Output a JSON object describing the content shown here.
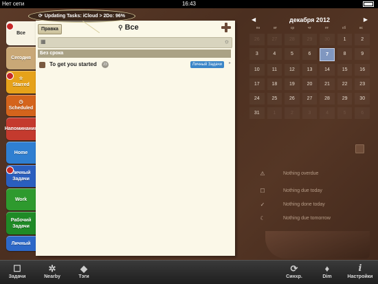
{
  "status_bar": {
    "carrier": "Нет сети",
    "time": "16:43",
    "battery_label": "Battery"
  },
  "sync_bubble": {
    "text": "Updating Tasks: iCloud > 2Do: 96%",
    "icon": "sync-icon"
  },
  "tabs": [
    {
      "label": "Все",
      "color": "#f7f3e4",
      "active": true,
      "icon": "",
      "badge": true
    },
    {
      "label": "Сегодня",
      "color": "#c9a877",
      "active": false,
      "icon": "",
      "badge": false
    },
    {
      "label": "Starred",
      "color": "#e6a21a",
      "active": false,
      "icon": "☆",
      "badge": true
    },
    {
      "label": "Scheduled",
      "color": "#d4641c",
      "active": false,
      "icon": "◷",
      "badge": false
    },
    {
      "label": "Напоминания",
      "color": "#c43a2e",
      "active": false,
      "icon": "",
      "badge": false
    },
    {
      "label": "Home",
      "color": "#2f7fd1",
      "active": false,
      "icon": "",
      "badge": false
    },
    {
      "label": "Личный Задачи",
      "color": "#2a5fbf",
      "active": false,
      "icon": "",
      "badge": true
    },
    {
      "label": "Work",
      "color": "#2e9a2e",
      "active": false,
      "icon": "",
      "badge": false
    },
    {
      "label": "Рабочий Задачи",
      "color": "#1f8a26",
      "active": false,
      "icon": "",
      "badge": false
    },
    {
      "label": "Личный",
      "color": "#2d68c8",
      "active": false,
      "icon": "",
      "badge": false
    }
  ],
  "header": {
    "edit_label": "Правка",
    "title": "Все",
    "search_icon": "magnifier-icon",
    "add_icon": "plus-icon"
  },
  "quick_entry": {
    "left_icon": "calendar-icon",
    "right_icon": "sun-icon"
  },
  "section": {
    "title": "Без срока"
  },
  "task": {
    "name": "To get you started",
    "count": "23",
    "list": "Личный Задачи",
    "list_color": "#3a86c8"
  },
  "calendar": {
    "month": "декабря 2012",
    "weekdays": [
      "пн",
      "вт",
      "ср",
      "чт",
      "пт",
      "сб",
      "вс"
    ],
    "days": [
      {
        "n": "26",
        "other": true
      },
      {
        "n": "27",
        "other": true
      },
      {
        "n": "28",
        "other": true
      },
      {
        "n": "29",
        "other": true
      },
      {
        "n": "30",
        "other": true
      },
      {
        "n": "1",
        "other": false
      },
      {
        "n": "2",
        "other": false
      },
      {
        "n": "3",
        "other": false
      },
      {
        "n": "4",
        "other": false
      },
      {
        "n": "5",
        "other": false
      },
      {
        "n": "6",
        "other": false
      },
      {
        "n": "7",
        "other": false,
        "today": true
      },
      {
        "n": "8",
        "other": false
      },
      {
        "n": "9",
        "other": false
      },
      {
        "n": "10",
        "other": false
      },
      {
        "n": "11",
        "other": false
      },
      {
        "n": "12",
        "other": false
      },
      {
        "n": "13",
        "other": false
      },
      {
        "n": "14",
        "other": false
      },
      {
        "n": "15",
        "other": false
      },
      {
        "n": "16",
        "other": false
      },
      {
        "n": "17",
        "other": false
      },
      {
        "n": "18",
        "other": false
      },
      {
        "n": "19",
        "other": false
      },
      {
        "n": "20",
        "other": false
      },
      {
        "n": "21",
        "other": false
      },
      {
        "n": "22",
        "other": false
      },
      {
        "n": "23",
        "other": false
      },
      {
        "n": "24",
        "other": false
      },
      {
        "n": "25",
        "other": false
      },
      {
        "n": "26",
        "other": false
      },
      {
        "n": "27",
        "other": false
      },
      {
        "n": "28",
        "other": false
      },
      {
        "n": "29",
        "other": false
      },
      {
        "n": "30",
        "other": false
      },
      {
        "n": "31",
        "other": false
      },
      {
        "n": "1",
        "other": true
      },
      {
        "n": "2",
        "other": true
      },
      {
        "n": "3",
        "other": true
      },
      {
        "n": "4",
        "other": true
      },
      {
        "n": "5",
        "other": true
      },
      {
        "n": "6",
        "other": true
      }
    ]
  },
  "summary": [
    {
      "icon": "warning-icon",
      "glyph": "⚠",
      "text": "Nothing overdue"
    },
    {
      "icon": "square-icon",
      "glyph": "☐",
      "text": "Nothing due today"
    },
    {
      "icon": "checkmark-icon",
      "glyph": "✓",
      "text": "Nothing done today"
    },
    {
      "icon": "moon-icon",
      "glyph": "☾",
      "text": "Nothing due tomorrow"
    }
  ],
  "toolbar": [
    {
      "label": "Задачи",
      "icon": "tasks-icon",
      "glyph": "☐"
    },
    {
      "label": "Nearby",
      "icon": "location-icon",
      "glyph": "✲"
    },
    {
      "label": "Тэги",
      "icon": "tag-icon",
      "glyph": "◆"
    },
    {
      "label": "Синхр.",
      "icon": "sync-icon",
      "glyph": "⟳"
    },
    {
      "label": "Dim",
      "icon": "lightbulb-icon",
      "glyph": "♦"
    },
    {
      "label": "Настройки",
      "icon": "info-icon",
      "glyph": "i"
    }
  ]
}
